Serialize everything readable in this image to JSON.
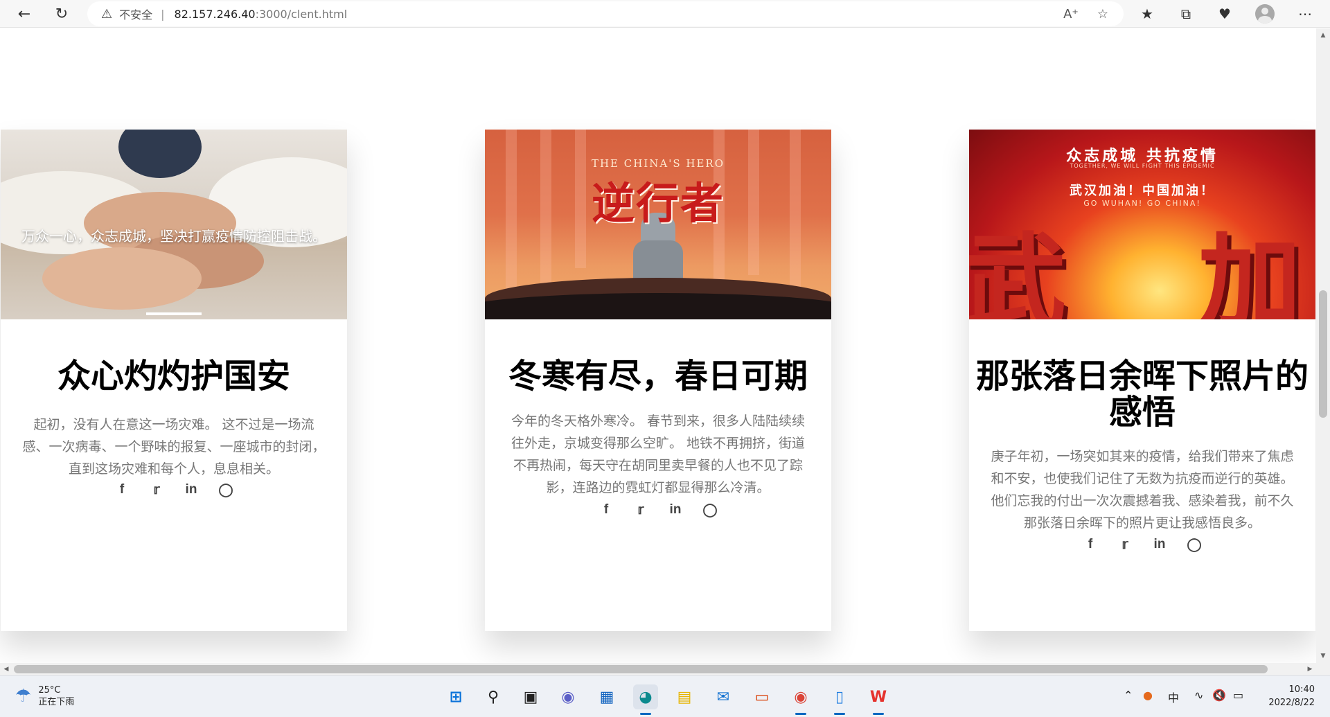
{
  "browser": {
    "insecure_label": "不安全",
    "url_host": "82.157.246.40",
    "url_path": ":3000/clent.html",
    "icons": [
      "back-icon",
      "refresh-icon",
      "warning-icon",
      "read-aloud-icon",
      "add-favorite-icon",
      "favorites-icon",
      "collections-icon",
      "health-icon",
      "profile-icon",
      "more-icon"
    ]
  },
  "cards": [
    {
      "image_caption": "万众一心，众志成城，坚决打赢疫情防控阻击战。",
      "title": "众心灼灼护国安",
      "text": "起初，没有人在意这一场灾难。 这不过是一场流感、一次病毒、一个野味的报复、一座城市的封闭， 直到这场灾难和每个人，息息相关。",
      "social": [
        "f",
        "t",
        "in",
        "ig"
      ]
    },
    {
      "image_sub": "THE CHINA'S HERO",
      "image_title": "逆行者",
      "title": "冬寒有尽，春日可期",
      "text": "今年的冬天格外寒冷。 春节到来，很多人陆陆续续往外走，京城变得那么空旷。 地铁不再拥挤，街道不再热闹，每天守在胡同里卖早餐的人也不见了踪影，连路边的霓虹灯都显得那么冷清。",
      "social": [
        "f",
        "t",
        "in",
        "ig"
      ]
    },
    {
      "image_line1": "众志成城 共抗疫情",
      "image_line2": "TOGETHER, WE WILL FIGHT THIS EPIDEMIC",
      "image_line3": "武汉加油！中国加油！",
      "image_line4": "GO WUHAN! GO CHINA!",
      "image_big_left": "武",
      "image_big_right": "加",
      "title": "那张落日余晖下照片的感悟",
      "text": "庚子年初，一场突如其来的疫情，给我们带来了焦虑和不安，也使我们记住了无数为抗疫而逆行的英雄。他们忘我的付出一次次震撼着我、感染着我，前不久那张落日余晖下的照片更让我感悟良多。",
      "social": [
        "f",
        "t",
        "in",
        "ig"
      ]
    }
  ],
  "taskbar": {
    "temperature": "25°C",
    "weather": "正在下雨",
    "ime": "中",
    "time": "10:40",
    "date": "2022/8/22"
  },
  "colors": {
    "accent": "#0067c0",
    "poster_red": "#c81b1b",
    "text_gray": "#777777"
  }
}
